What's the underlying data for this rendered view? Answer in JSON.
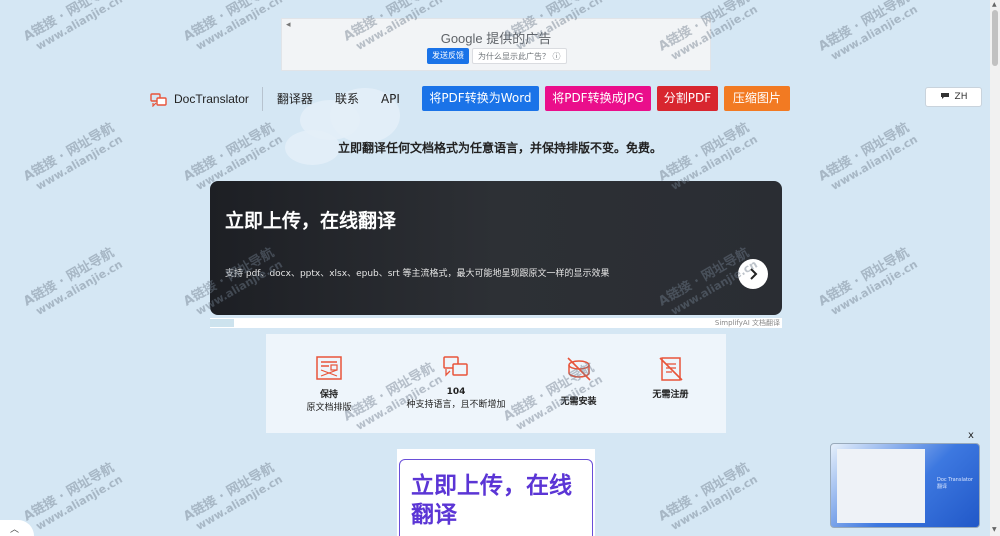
{
  "ad": {
    "back": "◂",
    "google_label": "Google 提供的广告",
    "feedback_label": "发送反馈",
    "why_label": "为什么显示此广告？ ⓘ"
  },
  "nav": {
    "brand": "DocTranslator",
    "links": [
      "翻译器",
      "联系",
      "API"
    ],
    "buttons": [
      "将PDF转换为Word",
      "将PDF转换成JPG",
      "分割PDF",
      "压缩图片"
    ],
    "lang": "ZH"
  },
  "tagline": "立即翻译任何文档格式为任意语言，并保持排版不变。免费。",
  "hero": {
    "title": "立即上传，在线翻译",
    "description": "支持 pdf、docx、pptx、xlsx、epub、srt 等主流格式，最大可能地呈现跟原文一样的显示效果",
    "footer_credit": "SimplifyAI 文档翻译"
  },
  "features": [
    {
      "icon": "layout-doc-icon",
      "line1": "保持",
      "line2": "原文档排版"
    },
    {
      "icon": "translate-icon",
      "line1": "104",
      "line2": "种支持语言，且不断增加"
    },
    {
      "icon": "no-install-icon",
      "line1": "无需安装",
      "line2": ""
    },
    {
      "icon": "no-register-icon",
      "line1": "无需注册",
      "line2": ""
    }
  ],
  "lower_card": {
    "title": "立即上传，在线翻译"
  },
  "float": {
    "close": "x",
    "caption": "Doc Translator 翻译"
  },
  "watermark": {
    "line1": "A链接 · 网址导航",
    "line2": "www.alianjie.cn"
  },
  "colors": {
    "accent_blue": "#1a73e8",
    "accent_pink": "#ea0e8b",
    "accent_red": "#d8262f",
    "accent_orange": "#f27a22",
    "brand_icon": "#e8543a",
    "lower_purple": "#5b35d5"
  }
}
